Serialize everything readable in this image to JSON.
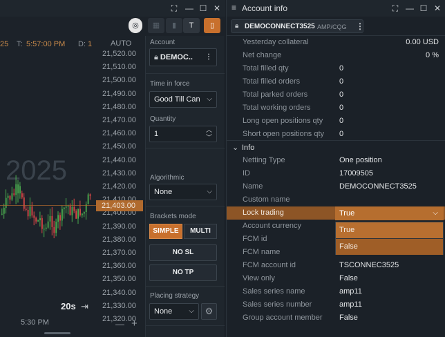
{
  "chart_window": {
    "info_row": {
      "year_frag": "25",
      "time_label": "T:",
      "time_value": "5:57:00 PM",
      "d_label": "D:",
      "d_value": "1"
    },
    "price_axis_header": "AUTO",
    "price_ticks": [
      "21,520.00",
      "21,510.00",
      "21,500.00",
      "21,490.00",
      "21,480.00",
      "21,470.00",
      "21,460.00",
      "21,450.00",
      "21,440.00",
      "21,430.00",
      "21,420.00",
      "21,410.00",
      "21,400.00",
      "21,390.00",
      "21,380.00",
      "21,370.00",
      "21,360.00",
      "21,350.00",
      "21,340.00",
      "21,330.00",
      "21,320.00"
    ],
    "current_price": "21,403.00",
    "watermark": "2025",
    "timeframe": "20s",
    "time_axis_label": "5:30 PM",
    "colors": {
      "up": "#4caf50",
      "down": "#e04848",
      "accent": "#b06a2e"
    }
  },
  "order_panel": {
    "account_label": "Account",
    "account_value": "DEMOC..",
    "tif_label": "Time in force",
    "tif_value": "Good Till Can",
    "quantity_label": "Quantity",
    "quantity_value": "1",
    "qty_buttons": [
      "1",
      "2",
      "5",
      "10",
      "X"
    ],
    "algo_label": "Algorithmic",
    "algo_value": "None",
    "brackets_label": "Brackets mode",
    "simple": "SIMPLE",
    "multi": "MULTI",
    "no_sl": "NO SL",
    "no_tp": "NO TP",
    "placing_label": "Placing strategy",
    "placing_value": "None"
  },
  "account_window": {
    "title": "Account info",
    "account_name": "DEMOCONNECT3525",
    "account_sub": "AMP/CQG",
    "stats": [
      {
        "key": "Yesterday collateral",
        "value": "0.00 USD",
        "align": "right"
      },
      {
        "key": "Net change",
        "value": "0 %",
        "align": "right"
      },
      {
        "key": "Total filled qty",
        "value": "0"
      },
      {
        "key": "Total filled orders",
        "value": "0"
      },
      {
        "key": "Total parked orders",
        "value": "0"
      },
      {
        "key": "Total working orders",
        "value": "0"
      },
      {
        "key": "Long open positions qty",
        "value": "0"
      },
      {
        "key": "Short open positions qty",
        "value": "0"
      }
    ],
    "info_section": "Info",
    "info_rows": [
      {
        "key": "Netting Type",
        "value": "One position"
      },
      {
        "key": "ID",
        "value": "17009505"
      },
      {
        "key": "Name",
        "value": "DEMOCONNECT3525"
      },
      {
        "key": "Custom name",
        "value": ""
      },
      {
        "key": "Lock trading",
        "value": ""
      },
      {
        "key": "Account currency",
        "value": ""
      },
      {
        "key": "FCM id",
        "value": ""
      },
      {
        "key": "FCM name",
        "value": ""
      },
      {
        "key": "FCM account id",
        "value": "TSCONNEC3525"
      },
      {
        "key": "View only",
        "value": "False"
      },
      {
        "key": "Sales series name",
        "value": "amp11"
      },
      {
        "key": "Sales series number",
        "value": "amp11"
      },
      {
        "key": "Group account member",
        "value": "False"
      }
    ],
    "lock_dropdown": {
      "selected": "True",
      "options": [
        "True",
        "False"
      ]
    }
  }
}
